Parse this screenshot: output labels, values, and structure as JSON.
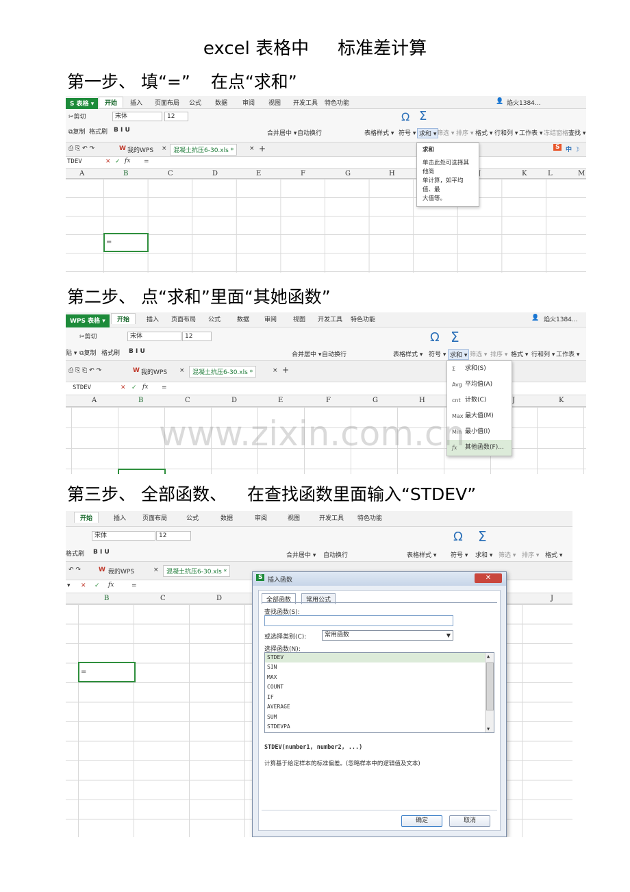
{
  "doc": {
    "title_left": "excel 表格中",
    "title_right": "标准差计算",
    "step1_left": "第一步、 填“=”",
    "step1_right": "在点“求和”",
    "step2": "第二步、 点“求和”里面“其她函数”",
    "step3_left": "第三步、 全部函数、",
    "step3_right": "在查找函数里面输入“STDEV”",
    "watermark": "www.zixin.com.cn"
  },
  "shot1": {
    "app_tag": "S 表格 ▾",
    "tabs": [
      "开始",
      "插入",
      "页面布局",
      "公式",
      "数据",
      "审阅",
      "视图",
      "开发工具",
      "特色功能"
    ],
    "user": "焰火1384...",
    "cut": "剪切",
    "copy": "复制",
    "format_painter": "格式刷",
    "font": "宋体",
    "size": "12",
    "merge": "合并居中 ▾",
    "wrap": "自动换行",
    "table_style": "表格样式 ▾",
    "symbol": "符号 ▾",
    "sum": "求和 ▾",
    "filter": "筛选 ▾",
    "sort": "排序 ▾",
    "format": "格式 ▾",
    "rowcol": "行和列 ▾",
    "sheet": "工作表 ▾",
    "freeze": "冻结窗格",
    "find": "查找 ▾",
    "my_wps": "我的WPS",
    "doc_tab": "混凝土抗压6-30.xls *",
    "name_box": "TDEV",
    "formula": "=",
    "cols": [
      "A",
      "B",
      "C",
      "D",
      "E",
      "F",
      "G",
      "H",
      "I",
      "J",
      "K",
      "L",
      "M"
    ],
    "cell_value": "=",
    "tooltip_title": "求和",
    "tooltip_line1": "单击此处可选择其他简",
    "tooltip_line2": "单计算，如平均值、最",
    "tooltip_line3": "大值等。"
  },
  "shot2": {
    "app_tag": "WPS 表格 ▾",
    "tabs": [
      "开始",
      "插入",
      "页面布局",
      "公式",
      "数据",
      "审阅",
      "视图",
      "开发工具",
      "特色功能"
    ],
    "user": "焰火1384...",
    "paste": "贴 ▾",
    "cut": "剪切",
    "copy": "复制",
    "format_painter": "格式刷",
    "font": "宋体",
    "size": "12",
    "merge": "合并居中 ▾",
    "wrap": "自动换行",
    "table_style": "表格样式 ▾",
    "symbol": "符号 ▾",
    "sum": "求和 ▾",
    "filter": "筛选 ▾",
    "sort": "排序 ▾",
    "format": "格式 ▾",
    "rowcol": "行和列 ▾",
    "sheet": "工作表 ▾",
    "my_wps": "我的WPS",
    "doc_tab": "混凝土抗压6-30.xls *",
    "name_box": "STDEV",
    "formula": "=",
    "cols": [
      "A",
      "B",
      "C",
      "D",
      "E",
      "F",
      "G",
      "H",
      "I",
      "J",
      "K"
    ],
    "menu": [
      {
        "icon": "Σ",
        "label": "求和(S)"
      },
      {
        "icon": "Avg",
        "label": "平均值(A)"
      },
      {
        "icon": "cnt",
        "label": "计数(C)"
      },
      {
        "icon": "Max",
        "label": "最大值(M)"
      },
      {
        "icon": "Min",
        "label": "最小值(I)"
      },
      {
        "icon": "fx",
        "label": "其他函数(F)..."
      }
    ]
  },
  "shot3": {
    "tabs": [
      "开始",
      "插入",
      "页面布局",
      "公式",
      "数据",
      "审阅",
      "视图",
      "开发工具",
      "特色功能"
    ],
    "format_painter": "格式刷",
    "font": "宋体",
    "size": "12",
    "merge": "合并居中 ▾",
    "wrap": "自动换行",
    "table_style": "表格样式 ▾",
    "symbol": "符号 ▾",
    "sum": "求和 ▾",
    "filter": "筛选 ▾",
    "sort": "排序 ▾",
    "format": "格式 ▾",
    "my_wps": "我的WPS",
    "doc_tab": "混凝土抗压6-30.xls *",
    "formula": "=",
    "col_b": "B",
    "col_c": "C",
    "col_d": "D",
    "col_j": "J",
    "cell_value": "=",
    "dialog": {
      "title": "插入函数",
      "close": "✕",
      "tab_all": "全部函数",
      "tab_common": "常用公式",
      "search_label": "查找函数(S):",
      "search_value": "",
      "category_label": "或选择类别(C):",
      "category_value": "常用函数",
      "select_label": "选择函数(N):",
      "functions": [
        "STDEV",
        "SIN",
        "MAX",
        "COUNT",
        "IF",
        "AVERAGE",
        "SUM",
        "STDEVPA"
      ],
      "signature": "STDEV(number1, number2, ...)",
      "description": "计算基于给定样本的标准偏差。(忽略样本中的逻辑值及文本)",
      "ok": "确定",
      "cancel": "取消"
    }
  }
}
